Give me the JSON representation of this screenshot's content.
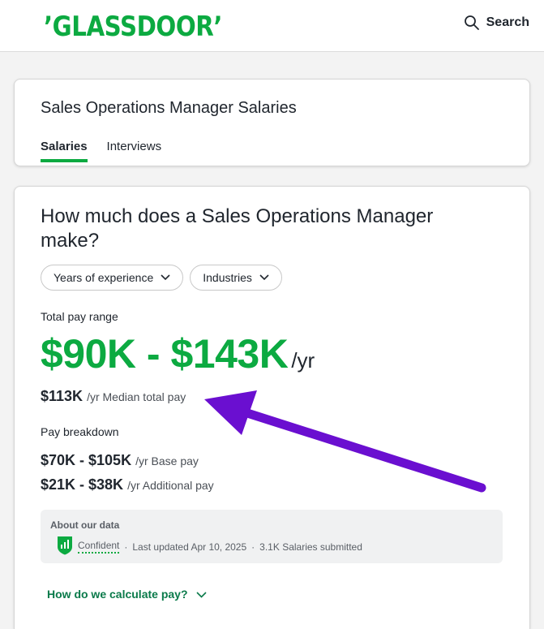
{
  "header": {
    "logo_text": "’GLASSDOOR’",
    "search_label": "Search"
  },
  "overview": {
    "title": "Sales Operations Manager Salaries",
    "tabs": [
      {
        "label": "Salaries",
        "active": true
      },
      {
        "label": "Interviews",
        "active": false
      }
    ]
  },
  "salary": {
    "question": "How much does a Sales Operations Manager make?",
    "filters": [
      "Years of experience",
      "Industries"
    ],
    "total_pay_label": "Total pay range",
    "range": "$90K - $143K",
    "range_unit": "/yr",
    "median_value": "$113K",
    "median_suffix": "/yr Median total pay",
    "breakdown_label": "Pay breakdown",
    "base_value": "$70K - $105K",
    "base_suffix": "/yr Base pay",
    "additional_value": "$21K - $38K",
    "additional_suffix": "/yr Additional pay"
  },
  "about": {
    "title": "About our data",
    "confidence": "Confident",
    "updated": "Last updated Apr 10, 2025",
    "submitted": "3.1K Salaries submitted",
    "separator": "·"
  },
  "calc_link": "How do we calculate pay?",
  "colors": {
    "brand_green": "#0caa41",
    "link_green": "#0a7a4a",
    "annotation_arrow": "#6a0fd0"
  },
  "icons": [
    "search-icon",
    "chevron-down-icon",
    "shield-check-icon",
    "arrow-annotation"
  ]
}
